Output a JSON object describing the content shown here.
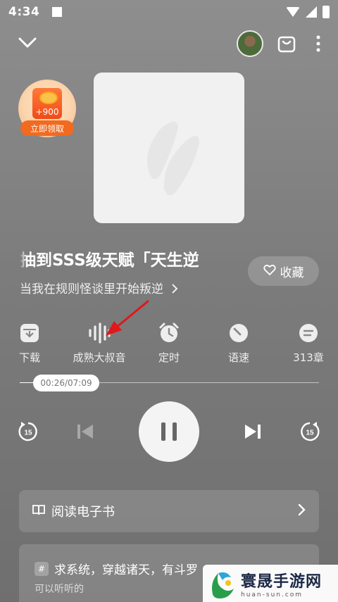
{
  "status_bar": {
    "time": "4:34"
  },
  "reward_badge": {
    "amount": "+900",
    "cta": "立即领取"
  },
  "book": {
    "title": "抽到SSS级天赋「天生逆",
    "subtitle": "当我在规则怪谈里开始叛逆",
    "favorite_label": "收藏"
  },
  "actions": [
    {
      "label": "下载",
      "icon": "download-icon"
    },
    {
      "label": "成熟大叔音",
      "icon": "voice-waveform-icon"
    },
    {
      "label": "定时",
      "icon": "alarm-clock-icon"
    },
    {
      "label": "语速",
      "icon": "speed-gauge-icon"
    },
    {
      "label": "313章",
      "icon": "chapter-list-icon"
    }
  ],
  "player": {
    "time_display": "00:26/07:09",
    "progress_fraction": 0.06,
    "skip_back_seconds": "15",
    "skip_forward_seconds": "15",
    "state": "playing"
  },
  "read_ebook": {
    "label": "阅读电子书"
  },
  "recommendation": {
    "title": "求系统，穿越诸天，有斗罗",
    "subtitle": "可以听听的"
  },
  "watermark": {
    "name": "寰晟手游网",
    "domain": "huan-sun.com"
  },
  "colors": {
    "accent_orange": "#f26a1f",
    "annotation_red": "#e0171b"
  }
}
